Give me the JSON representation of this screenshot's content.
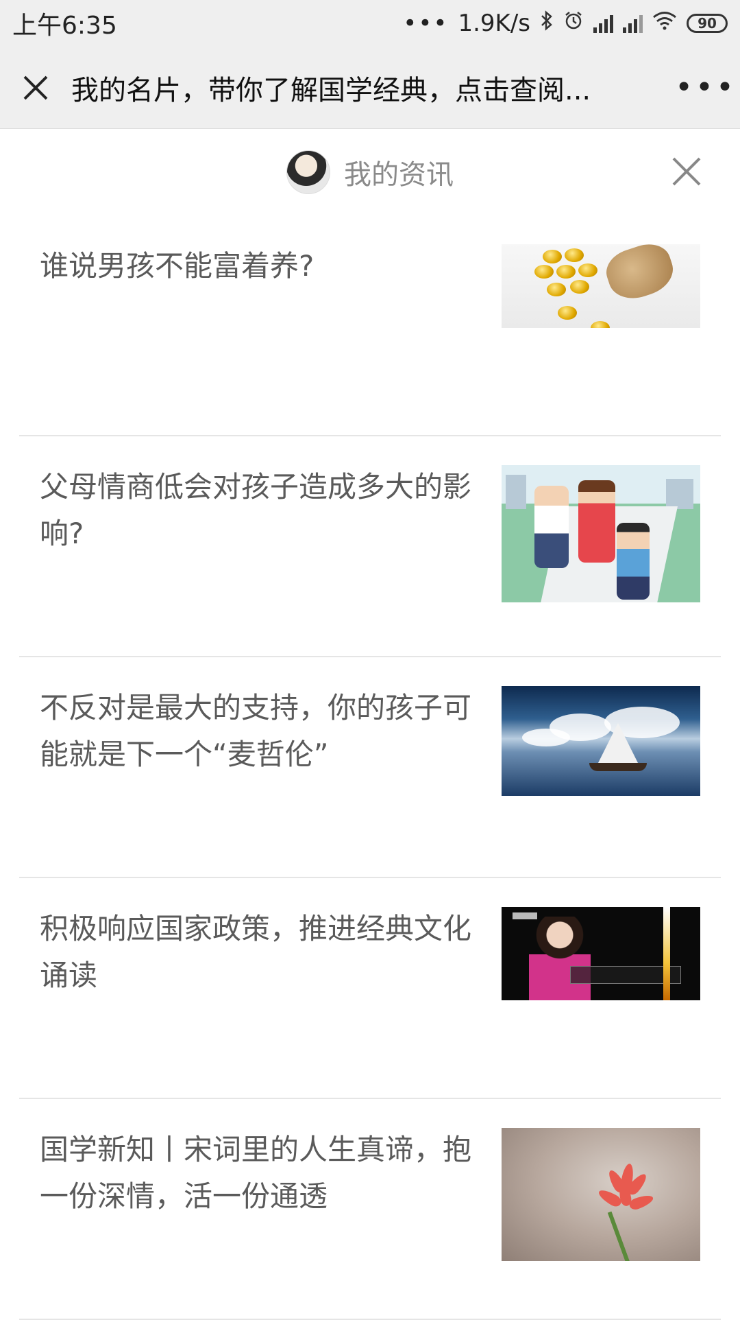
{
  "status_bar": {
    "time": "上午6:35",
    "dots": "•••",
    "speed": "1.9K/s",
    "battery": "90"
  },
  "nav": {
    "title": "我的名片，带你了解国学经典，点击查阅...",
    "more_label": "•••"
  },
  "panel": {
    "title": "我的资讯"
  },
  "articles": [
    {
      "title": "谁说男孩不能富着养?"
    },
    {
      "title": "父母情商低会对孩子造成多大的影响?"
    },
    {
      "title": "不反对是最大的支持，你的孩子可能就是下一个“麦哲伦”"
    },
    {
      "title": "积极响应国家政策，推进经典文化诵读"
    },
    {
      "title": "国学新知丨宋词里的人生真谛，抱一份深情，活一份通透"
    }
  ],
  "icons": {
    "bluetooth": "bluetooth-icon",
    "alarm": "alarm-icon",
    "wifi": "wifi-icon",
    "close": "close-icon"
  }
}
